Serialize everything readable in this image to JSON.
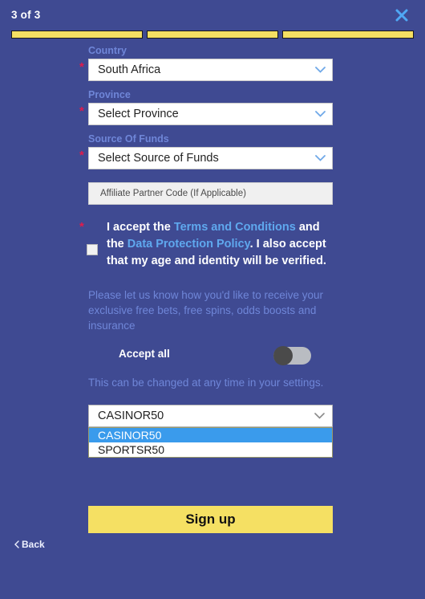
{
  "header": {
    "step_label": "3 of 3",
    "close_icon": "close-x-icon",
    "progress_total": 3,
    "progress_completed": 3
  },
  "colors": {
    "background": "#3f4a92",
    "accent_yellow": "#f5e063",
    "label_blue": "#6f86d8",
    "link_blue": "#5fa8ee",
    "required_red": "#e01b4c",
    "option_highlight": "#3a9bec",
    "close_icon": "#4fa8f5"
  },
  "fields": {
    "country": {
      "label": "Country",
      "value": "South Africa",
      "required_marker": "*",
      "chevron_icon": "chevron-down-icon"
    },
    "province": {
      "label": "Province",
      "value": "Select Province",
      "required_marker": "*",
      "chevron_icon": "chevron-down-icon"
    },
    "source_of_funds": {
      "label": "Source Of Funds",
      "value": "Select Source of Funds",
      "required_marker": "*",
      "chevron_icon": "chevron-down-icon"
    },
    "affiliate": {
      "value": "",
      "placeholder": "Affiliate Partner Code (If Applicable)"
    }
  },
  "terms": {
    "required_marker": "*",
    "checked": false,
    "part1": "I accept the ",
    "link1": "Terms and Conditions",
    "part2": " and the ",
    "link2": "Data Protection Policy",
    "part3": ". I also accept that my age and identity will be verified."
  },
  "marketing": {
    "intro": "Please let us know how you'd like to receive your exclusive free bets, free spins, odds boosts and insurance",
    "accept_all_label": "Accept all",
    "accept_all_enabled": false,
    "note": "This can be changed at any time in your settings."
  },
  "promo": {
    "selected": "CASINOR50",
    "chevron_icon": "chevron-down-icon",
    "expanded": true,
    "options": [
      {
        "label": "CASINOR50",
        "selected": true
      },
      {
        "label": "SPORTSR50",
        "selected": false
      }
    ]
  },
  "actions": {
    "signup_label": "Sign up",
    "back_label": "Back",
    "back_icon": "chevron-left-icon"
  }
}
